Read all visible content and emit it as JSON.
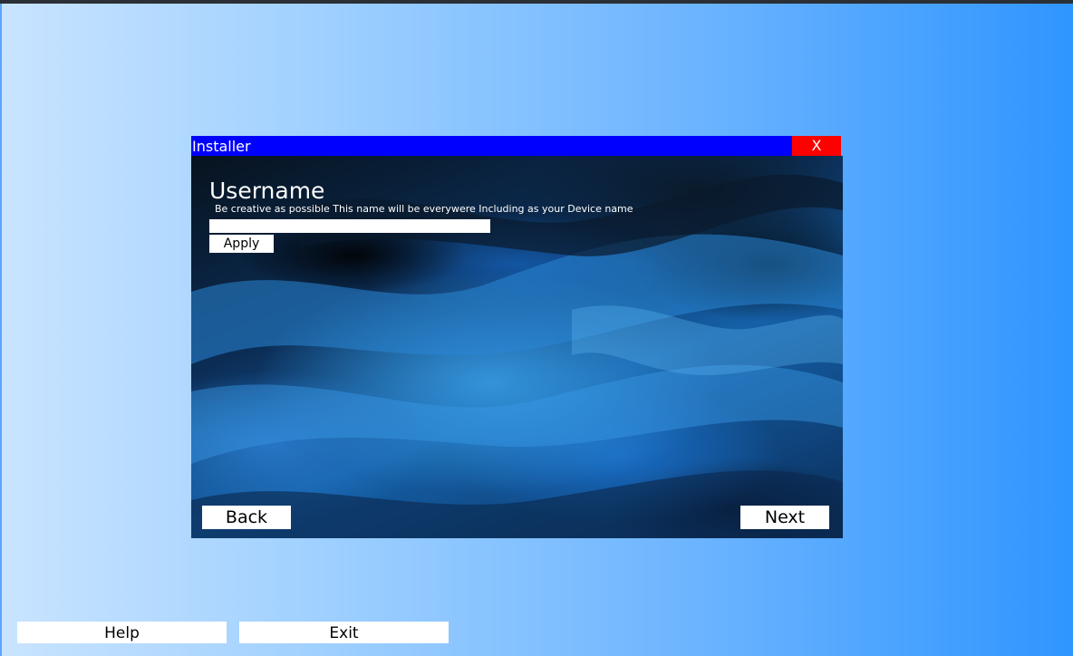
{
  "window": {
    "title": "Installer",
    "close_label": "X"
  },
  "page": {
    "heading": "Username",
    "description": "Be creative as possible This name will be everywere Including as your Device name",
    "username_value": "",
    "apply_label": "Apply",
    "back_label": "Back",
    "next_label": "Next"
  },
  "desktop": {
    "help_label": "Help",
    "exit_label": "Exit"
  },
  "colors": {
    "titlebar": "#0000ff",
    "close_button": "#ff0000",
    "desktop_gradient_start": "#c9e4ff",
    "desktop_gradient_end": "#2f95ff"
  },
  "icons": {
    "close": "close-icon"
  }
}
